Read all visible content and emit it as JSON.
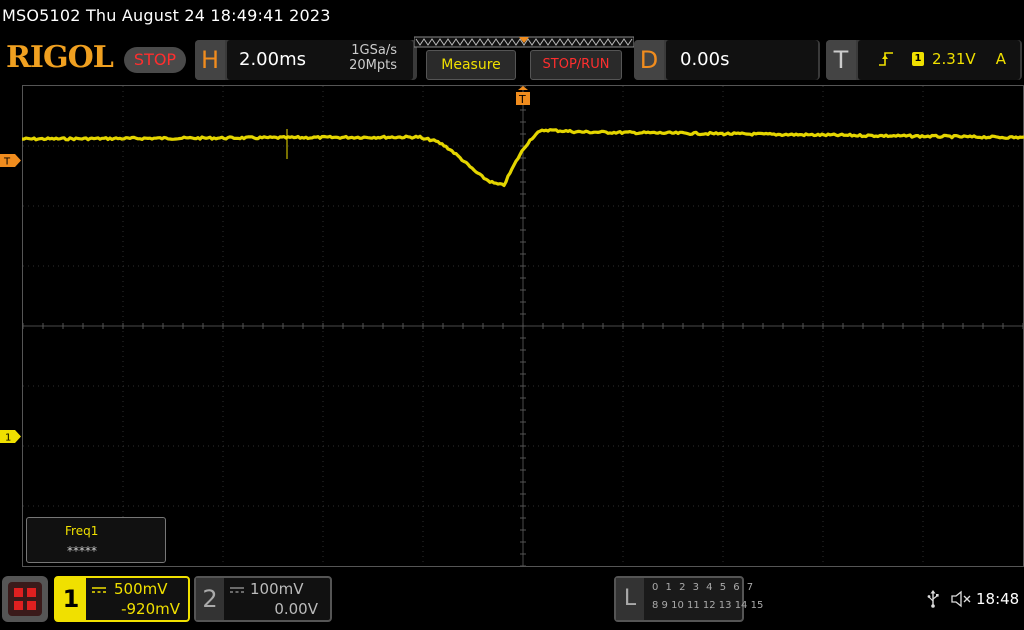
{
  "title_bar": {
    "text": "MSO5102  Thu August 24 18:49:41 2023"
  },
  "toolbar": {
    "logo": "RIGOL",
    "run_state": "STOP",
    "horizontal": {
      "letter": "H",
      "timebase": "2.00ms",
      "sample_rate": "1GSa/s",
      "memory_depth": "20Mpts"
    },
    "measure_label": "Measure",
    "stop_run_label": "STOP/RUN",
    "delay": {
      "letter": "D",
      "value": "0.00s"
    },
    "trigger": {
      "letter": "T",
      "edge_icon": "rising-edge-icon",
      "channel": "1",
      "level": "2.31V",
      "mode": "A"
    }
  },
  "markers": {
    "trigger_level_label": "T",
    "channel1_label": "1",
    "trigger_pos_label": "T"
  },
  "measurement": {
    "name": "Freq1",
    "value": "*****"
  },
  "channel1": {
    "number": "1",
    "coupling_icon": "dc-coupling-icon",
    "scale": "500mV",
    "offset": "-920mV"
  },
  "channel2": {
    "number": "2",
    "coupling_icon": "dc-coupling-icon",
    "scale": "100mV",
    "offset": "0.00V"
  },
  "logic_analyzer": {
    "letter": "L",
    "row1": "0 1 2 3  4 5 6 7",
    "row2": "8  9 10 11  12 13 14 15"
  },
  "status": {
    "clock": "18:48",
    "usb_icon": "usb-icon",
    "speaker_icon": "speaker-muted-icon"
  },
  "colors": {
    "channel1": "#f0e000",
    "accent": "#f08c1e",
    "stop": "#ff2e2e"
  }
}
